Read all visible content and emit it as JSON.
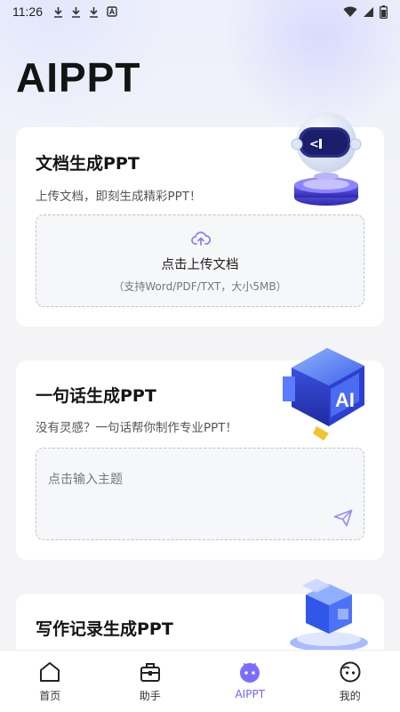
{
  "status_bar": {
    "time": "11:26"
  },
  "header": {
    "title": "AIPPT"
  },
  "doc_card": {
    "title": "文档生成PPT",
    "subtitle": "上传文档，即刻生成精彩PPT！",
    "upload_label": "点击上传文档",
    "upload_hint": "（支持Word/PDF/TXT，大小5MB）"
  },
  "sentence_card": {
    "title": "一句话生成PPT",
    "subtitle": "没有灵感？一句话帮你制作专业PPT！",
    "input_placeholder": "点击输入主题"
  },
  "record_card": {
    "title": "写作记录生成PPT"
  },
  "tabbar": {
    "items": [
      {
        "label": "首页",
        "icon": "home-icon"
      },
      {
        "label": "助手",
        "icon": "toolbox-icon"
      },
      {
        "label": "AIPPT",
        "icon": "robot-icon"
      },
      {
        "label": "我的",
        "icon": "profile-face-icon"
      }
    ],
    "active_index": 2
  },
  "colors": {
    "accent": "#6c63ff",
    "background": "#f4f4f7",
    "card": "#ffffff"
  }
}
